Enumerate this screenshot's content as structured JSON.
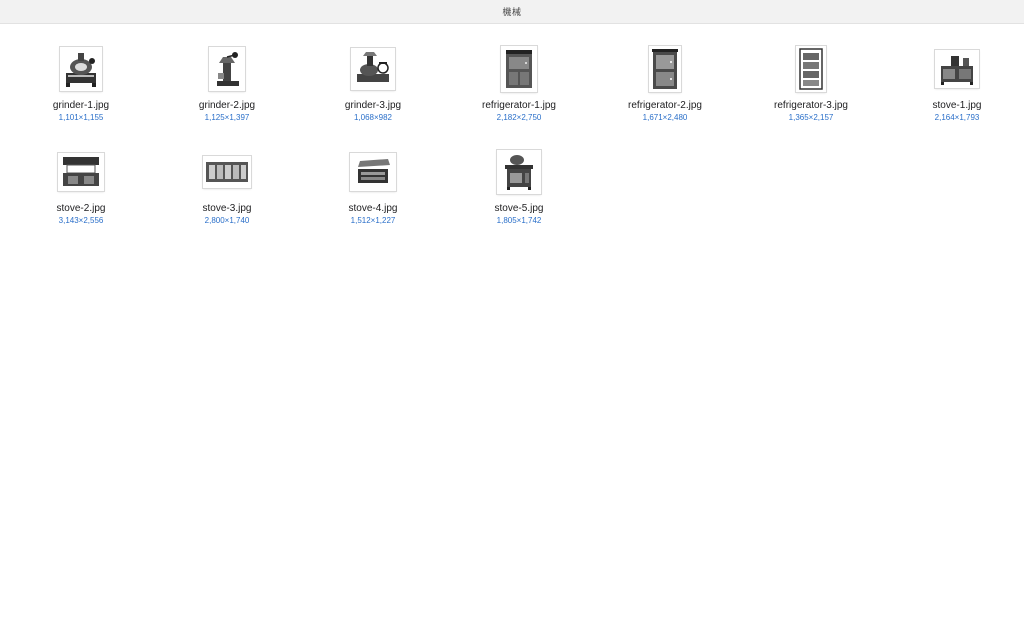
{
  "window": {
    "title": "機械"
  },
  "files": [
    {
      "name": "grinder-1.jpg",
      "dims": "1,101×1,155",
      "icon": "grinder-engraving-icon"
    },
    {
      "name": "grinder-2.jpg",
      "dims": "1,125×1,397",
      "icon": "grinder-engraving-icon"
    },
    {
      "name": "grinder-3.jpg",
      "dims": "1,068×982",
      "icon": "grinder-engraving-icon"
    },
    {
      "name": "refrigerator-1.jpg",
      "dims": "2,182×2,750",
      "icon": "refrigerator-engraving-icon"
    },
    {
      "name": "refrigerator-2.jpg",
      "dims": "1,671×2,480",
      "icon": "refrigerator-engraving-icon"
    },
    {
      "name": "refrigerator-3.jpg",
      "dims": "1,365×2,157",
      "icon": "refrigerator-engraving-icon"
    },
    {
      "name": "stove-1.jpg",
      "dims": "2,164×1,793",
      "icon": "stove-engraving-icon"
    },
    {
      "name": "stove-2.jpg",
      "dims": "3,143×2,556",
      "icon": "stove-engraving-icon"
    },
    {
      "name": "stove-3.jpg",
      "dims": "2,800×1,740",
      "icon": "stove-engraving-icon"
    },
    {
      "name": "stove-4.jpg",
      "dims": "1,512×1,227",
      "icon": "stove-engraving-icon"
    },
    {
      "name": "stove-5.jpg",
      "dims": "1,805×1,742",
      "icon": "stove-engraving-icon"
    }
  ],
  "colors": {
    "dims_text": "#2a6fc9",
    "titlebar_bg": "#f2f2f2"
  }
}
